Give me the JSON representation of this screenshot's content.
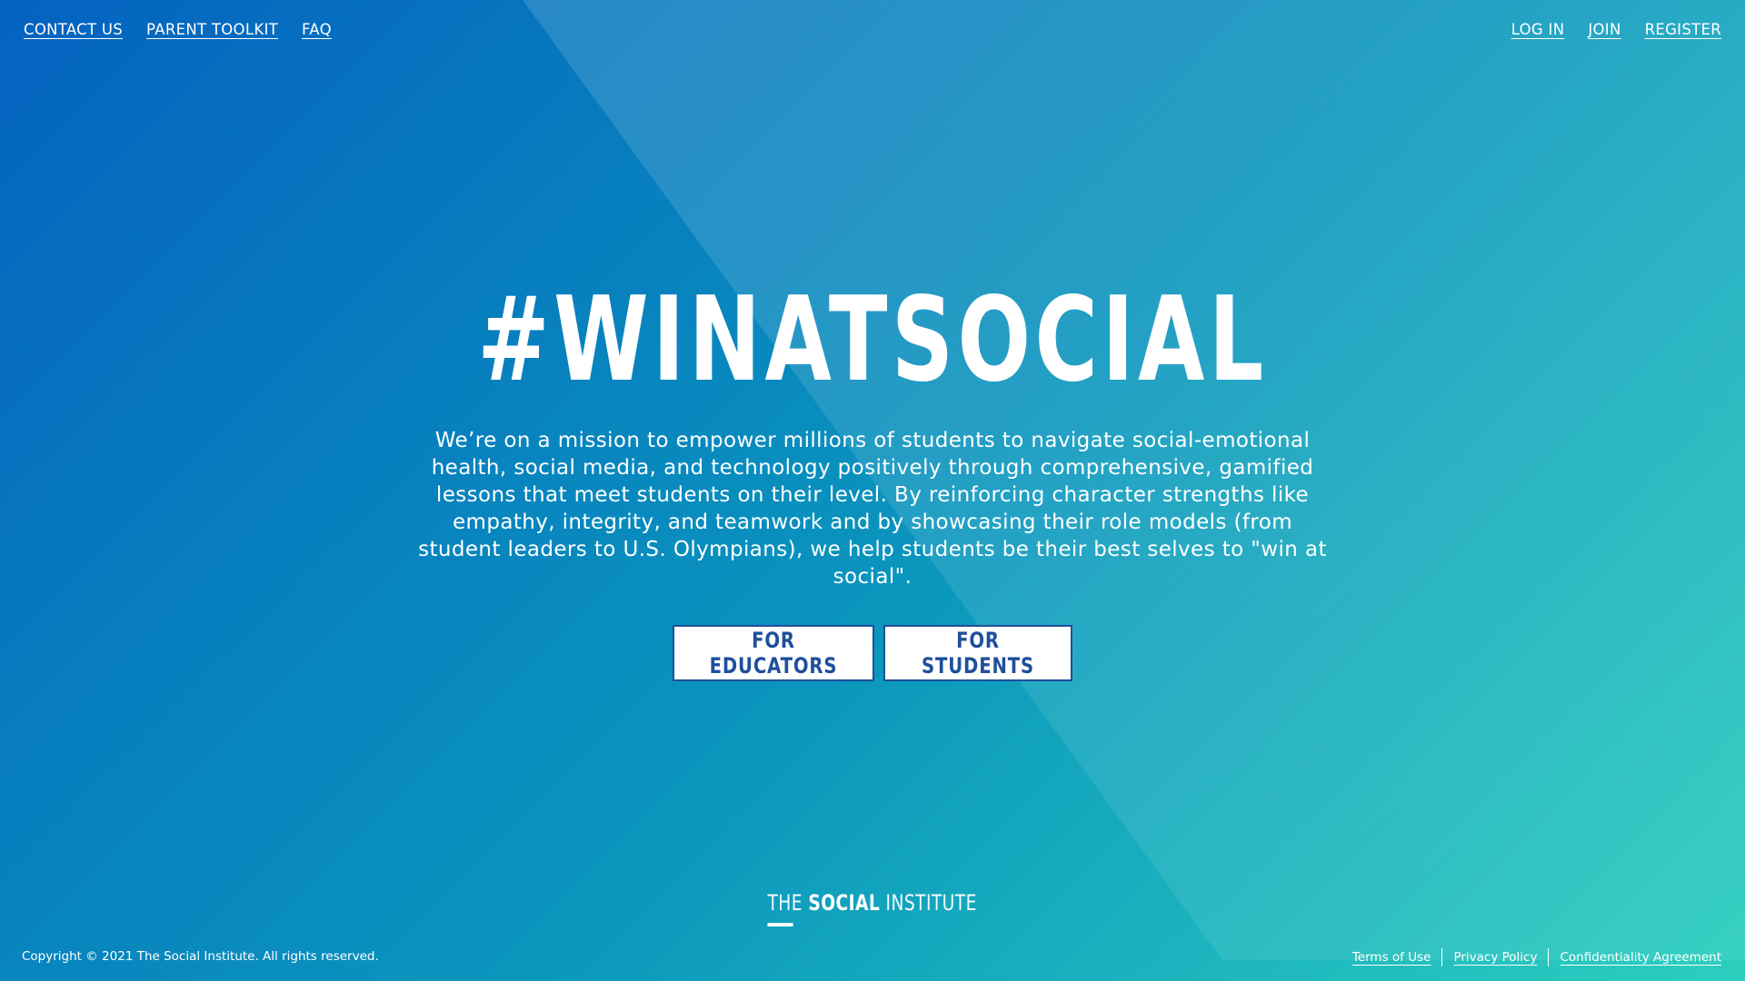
{
  "nav": {
    "left": [
      {
        "label": "CONTACT US"
      },
      {
        "label": "PARENT TOOLKIT"
      },
      {
        "label": "FAQ"
      }
    ],
    "right": [
      {
        "label": "LOG IN"
      },
      {
        "label": "JOIN"
      },
      {
        "label": "REGISTER"
      }
    ]
  },
  "hero": {
    "title": "#WINATSOCIAL",
    "description": "We’re on a mission to empower millions of students to navigate social-emotional health, social media, and technology positively through comprehensive, gamified lessons that meet students on their level. By reinforcing character strengths like empathy, integrity, and teamwork and by showcasing their role models (from student leaders to U.S. Olympians), we help students be their best selves to \"win at social\".",
    "buttons": {
      "educators": "FOR EDUCATORS",
      "students": "FOR STUDENTS"
    }
  },
  "footer": {
    "logo": {
      "the": "THE ",
      "social": "SOCIAL",
      "institute": " INSTITUTE"
    },
    "copyright": "Copyright © 2021 The Social Institute. All rights reserved.",
    "links": {
      "terms": "Terms of Use",
      "privacy": "Privacy Policy",
      "confidentiality": "Confidentiality Agreement"
    }
  },
  "colors": {
    "gradient_start": "#0462c0",
    "gradient_mid": "#0a96bd",
    "gradient_end": "#2ccfbe",
    "button_text": "#1f4f9c",
    "text": "#ffffff"
  }
}
